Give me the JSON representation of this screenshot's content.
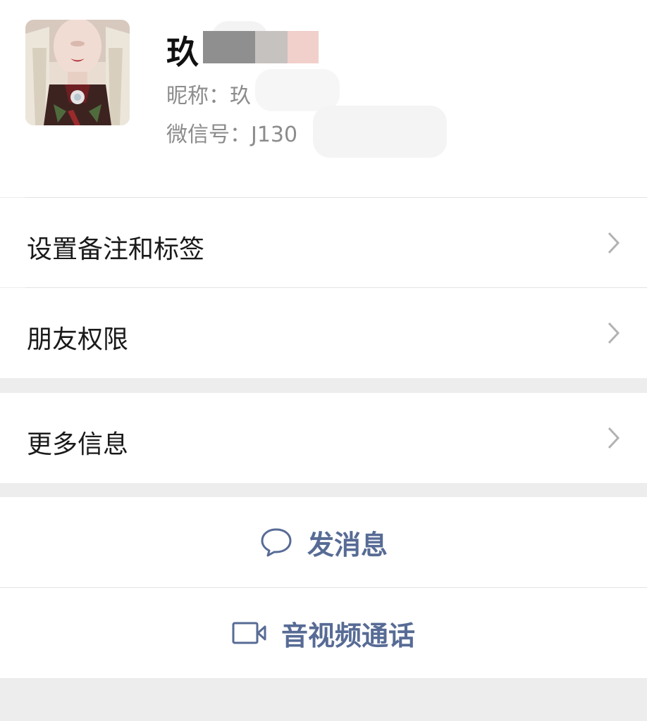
{
  "profile": {
    "name": "玖",
    "nickname": "昵称：玖",
    "wechat_id": "微信号：J130"
  },
  "menu": {
    "remark_tags": "设置备注和标签",
    "friend_permissions": "朋友权限",
    "more_info": "更多信息"
  },
  "actions": {
    "send_message": "发消息",
    "video_call": "音视频通话"
  },
  "colors": {
    "link": "#576b95",
    "background": "#ededed",
    "chevron": "#b2b2b2"
  },
  "icons": {
    "send_message": "chat-bubble-icon",
    "video_call": "video-camera-icon",
    "row_arrow": "chevron-right-icon"
  }
}
